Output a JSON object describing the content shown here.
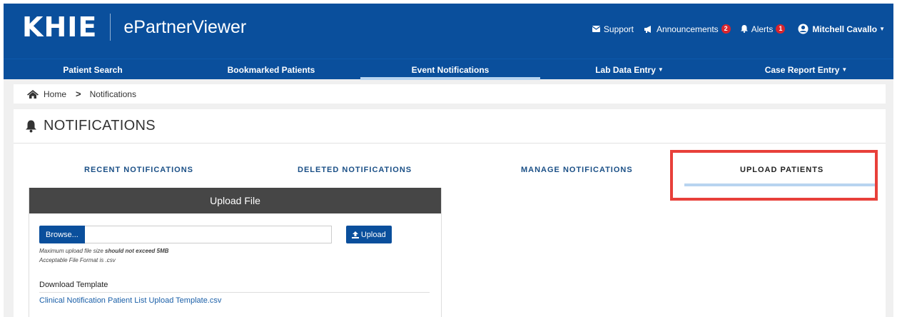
{
  "header": {
    "logo": "KHIE",
    "app_title": "ePartnerViewer",
    "support": "Support",
    "announcements": "Announcements",
    "announcements_count": "2",
    "alerts": "Alerts",
    "alerts_count": "1",
    "user": "Mitchell Cavallo"
  },
  "nav": {
    "items": [
      {
        "label": "Patient Search"
      },
      {
        "label": "Bookmarked Patients"
      },
      {
        "label": "Event Notifications"
      },
      {
        "label": "Lab Data Entry"
      },
      {
        "label": "Case Report Entry"
      }
    ],
    "active": "Event Notifications"
  },
  "breadcrumb": {
    "home": "Home",
    "current": "Notifications"
  },
  "page": {
    "title": "NOTIFICATIONS"
  },
  "tabs": {
    "items": [
      {
        "label": "RECENT NOTIFICATIONS"
      },
      {
        "label": "DELETED NOTIFICATIONS"
      },
      {
        "label": "MANAGE NOTIFICATIONS"
      },
      {
        "label": "UPLOAD PATIENTS"
      }
    ],
    "active": "UPLOAD PATIENTS"
  },
  "upload": {
    "panel_title": "Upload File",
    "browse_label": "Browse...",
    "file_value": "",
    "upload_label": "Upload",
    "size_note_prefix": "Maximum upload file size ",
    "size_note_bold": "should not exceed 5MB",
    "format_note": "Acceptable File Format is .csv",
    "download_title": "Download Template",
    "template_link": "Clinical Notification Patient List Upload Template.csv"
  },
  "colors": {
    "brand_blue": "#0a4f9c",
    "tab_underline": "#b8d4f0",
    "highlight_red": "#e8403a",
    "badge_red": "#d9252d",
    "panel_header": "#464646"
  },
  "icons": [
    "envelope-icon",
    "megaphone-icon",
    "bell-icon",
    "user-circle-icon",
    "home-icon",
    "chevron-right-icon",
    "upload-icon",
    "caret-down-icon"
  ]
}
